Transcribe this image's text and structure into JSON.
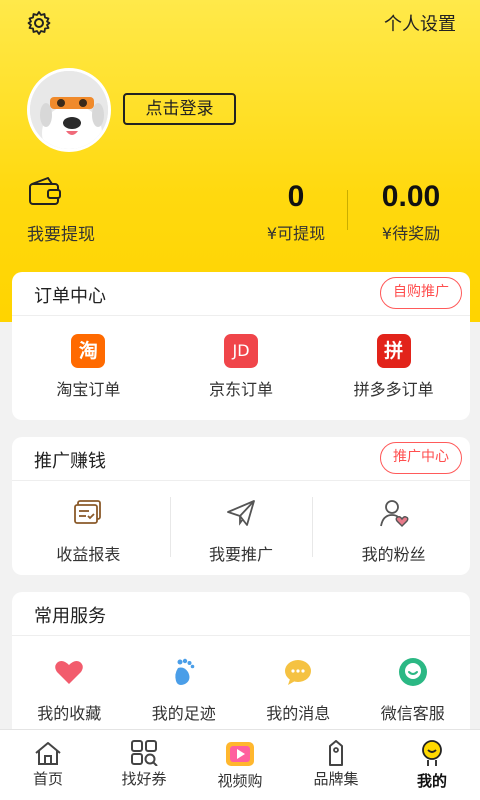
{
  "header": {
    "settings_link": "个人设置",
    "gear_icon": "gear-icon",
    "login_button": "点击登录",
    "withdraw_label": "我要提现"
  },
  "stats": [
    {
      "value": "0",
      "label": "¥可提现"
    },
    {
      "value": "0.00",
      "label": "¥待奖励"
    }
  ],
  "orders": {
    "title": "订单中心",
    "badge": "自购推广",
    "items": [
      {
        "label": "淘宝订单",
        "icon_text": "淘",
        "color": "#ff6a00",
        "icon": "taobao-icon"
      },
      {
        "label": "京东订单",
        "icon_text": "JD",
        "color": "#f0454a",
        "icon": "jd-icon"
      },
      {
        "label": "拼多多订单",
        "icon_text": "拼",
        "color": "#e2231a",
        "icon": "pinduoduo-icon"
      }
    ]
  },
  "promo": {
    "title": "推广赚钱",
    "badge": "推广中心",
    "items": [
      {
        "label": "收益报表",
        "icon": "report-icon"
      },
      {
        "label": "我要推广",
        "icon": "paper-plane-icon"
      },
      {
        "label": "我的粉丝",
        "icon": "fans-icon"
      }
    ]
  },
  "services": {
    "title": "常用服务",
    "items": [
      {
        "label": "我的收藏",
        "icon": "heart-icon"
      },
      {
        "label": "我的足迹",
        "icon": "footprint-icon"
      },
      {
        "label": "我的消息",
        "icon": "message-icon"
      },
      {
        "label": "微信客服",
        "icon": "wechat-service-icon"
      }
    ]
  },
  "tabbar": [
    {
      "label": "首页",
      "icon": "home-icon"
    },
    {
      "label": "找好券",
      "icon": "coupon-grid-icon"
    },
    {
      "label": "视频购",
      "icon": "video-icon"
    },
    {
      "label": "品牌集",
      "icon": "brand-tag-icon"
    },
    {
      "label": "我的",
      "icon": "profile-icon",
      "active": true
    }
  ],
  "colors": {
    "accent_yellow": "#ffd900",
    "badge_red": "#ff4f4f",
    "heart_pink": "#f25c6d",
    "footprint_blue": "#4a9ee8",
    "message_yellow": "#f5c242",
    "wechat_green": "#2bb884"
  }
}
